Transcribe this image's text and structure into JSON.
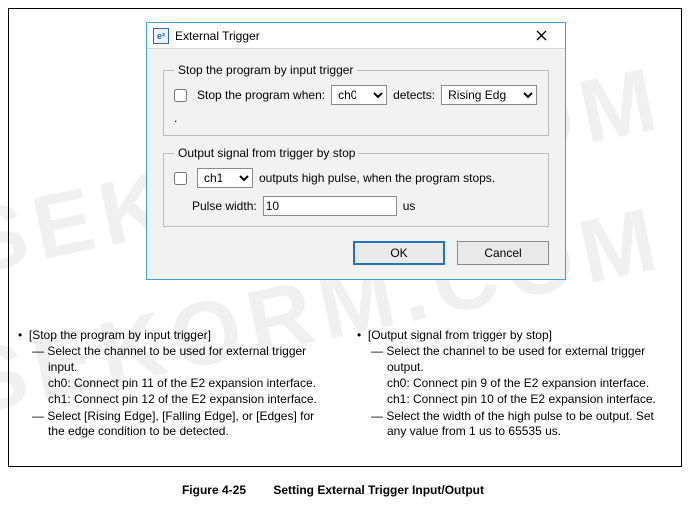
{
  "dialog": {
    "icon_text": "e²",
    "title": "External Trigger",
    "group1": {
      "legend": "Stop the program by input trigger",
      "checkbox_label": "Stop the program when:",
      "channel_selected": "ch0",
      "detects_label": "detects:",
      "edge_selected": "Rising Edge",
      "trailing_dot": "."
    },
    "group2": {
      "legend": "Output signal from trigger by stop",
      "channel_selected": "ch1",
      "post_text": "outputs high pulse, when the program stops.",
      "pulse_label": "Pulse width:",
      "pulse_value": "10",
      "pulse_unit": "us"
    },
    "buttons": {
      "ok": "OK",
      "cancel": "Cancel"
    }
  },
  "notes": {
    "left": {
      "heading": "[Stop the program by input trigger]",
      "l1": "Select the channel to be used for external trigger input.",
      "l1a": "ch0: Connect pin 11 of the E2 expansion interface.",
      "l1b": "ch1: Connect pin 12 of the E2 expansion interface.",
      "l2": "Select [Rising Edge], [Falling Edge], or [Edges] for the edge condition to be detected."
    },
    "right": {
      "heading": "[Output signal from trigger by stop]",
      "l1": "Select the channel to be used for external trigger output.",
      "l1a": "ch0: Connect pin 9 of the E2 expansion interface.",
      "l1b": "ch1: Connect pin 10 of the E2 expansion interface.",
      "l2": "Select the width of the high pulse to be output. Set any value from 1 us to 65535 us."
    }
  },
  "caption": {
    "fig": "Figure 4-25",
    "title": "Setting External Trigger Input/Output"
  }
}
